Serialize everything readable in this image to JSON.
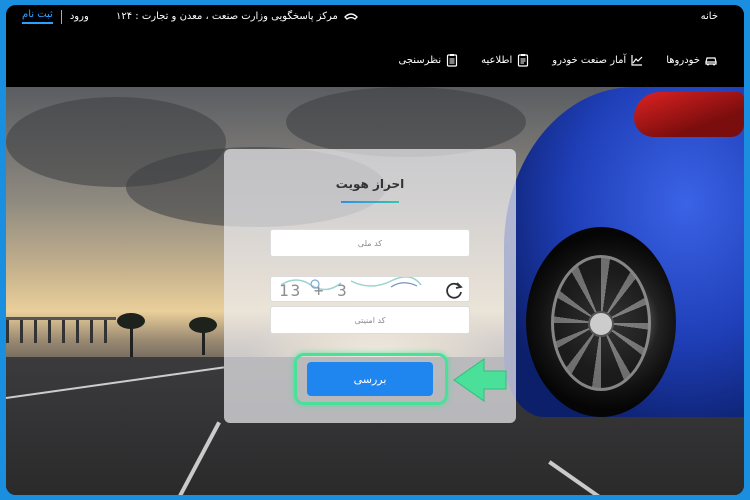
{
  "header": {
    "home_label": "خانه",
    "support_center": "مرکز پاسخگویی وزارت صنعت ، معدن و تجارت : ۱۲۴",
    "login_label": "ورود",
    "register_label": "ثبت نام"
  },
  "nav": {
    "items": [
      {
        "label": "خودروها",
        "icon": "car-icon"
      },
      {
        "label": "آمار صنعت خودرو",
        "icon": "chart-icon"
      },
      {
        "label": "اطلاعیه",
        "icon": "clipboard-icon"
      },
      {
        "label": "نظرسنجی",
        "icon": "clipboard-check-icon"
      }
    ]
  },
  "auth": {
    "title": "احراز هویت",
    "national_code_placeholder": "کد ملی",
    "captcha_text": "13 + 3",
    "security_code_placeholder": "کد امنیتی",
    "submit_label": "بررسی"
  },
  "colors": {
    "accent": "#1f86f0",
    "highlight": "#4ae09a",
    "frame": "#1a8fe0"
  }
}
